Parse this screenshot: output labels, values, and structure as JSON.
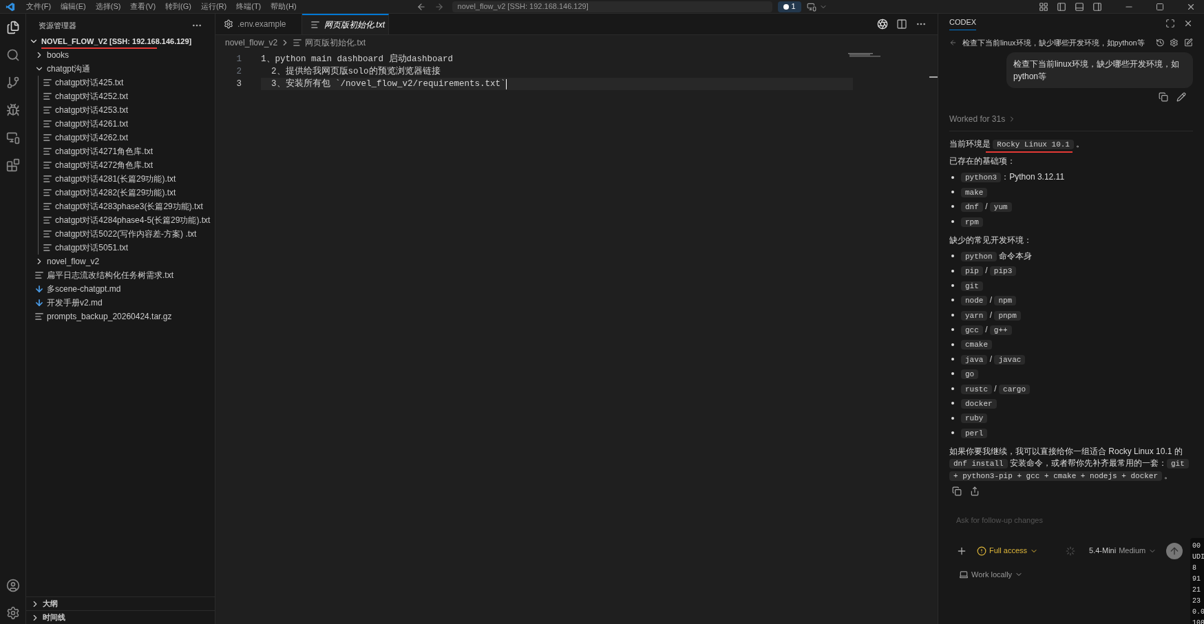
{
  "menu_bar": {
    "items": [
      "文件(F)",
      "编辑(E)",
      "选择(S)",
      "查看(V)",
      "转到(G)",
      "运行(R)",
      "终端(T)",
      "帮助(H)"
    ],
    "search": "novel_flow_v2 [SSH: 192.168.146.129]",
    "badge": "1"
  },
  "explorer": {
    "title": "资源管理器",
    "root": {
      "label": "NOVEL_FLOW_V2 [SSH: 192.168.146.129]",
      "expanded": true,
      "underlined": true
    },
    "tree": [
      {
        "kind": "folder",
        "label": "books",
        "expanded": false
      },
      {
        "kind": "folder",
        "label": "chatgpt沟通",
        "expanded": true,
        "children": [
          {
            "kind": "txt",
            "label": "chatgpt对话425.txt"
          },
          {
            "kind": "txt",
            "label": "chatgpt对话4252.txt"
          },
          {
            "kind": "txt",
            "label": "chatgpt对话4253.txt"
          },
          {
            "kind": "txt",
            "label": "chatgpt对话4261.txt"
          },
          {
            "kind": "txt",
            "label": "chatgpt对话4262.txt"
          },
          {
            "kind": "txt",
            "label": "chatgpt对话4271角色库.txt"
          },
          {
            "kind": "txt",
            "label": "chatgpt对话4272角色库.txt"
          },
          {
            "kind": "txt",
            "label": "chatgpt对话4281(长篇29功能).txt"
          },
          {
            "kind": "txt",
            "label": "chatgpt对话4282(长篇29功能).txt"
          },
          {
            "kind": "txt",
            "label": "chatgpt对话4283phase3(长篇29功能).txt"
          },
          {
            "kind": "txt",
            "label": "chatgpt对话4284phase4-5(长篇29功能).txt"
          },
          {
            "kind": "txt",
            "label": "chatgpt对话5022(写作内容差-方案) .txt"
          },
          {
            "kind": "txt",
            "label": "chatgpt对话5051.txt"
          }
        ]
      },
      {
        "kind": "folder",
        "label": "novel_flow_v2",
        "expanded": false
      },
      {
        "kind": "txt",
        "label": "扁平日志流改结构化任务树需求.txt"
      },
      {
        "kind": "md",
        "label": "多scene-chatgpt.md"
      },
      {
        "kind": "md",
        "label": "开发手册v2.md"
      },
      {
        "kind": "txt",
        "label": "prompts_backup_20260424.tar.gz"
      }
    ],
    "sections": [
      {
        "label": "大纲",
        "expanded": false
      },
      {
        "label": "时间线",
        "expanded": false
      }
    ]
  },
  "editor": {
    "tabs": [
      {
        "label": ".env.example",
        "kind": "config",
        "selected": false
      },
      {
        "label": "网页版初始化.txt",
        "kind": "txt",
        "selected": true
      }
    ],
    "breadcrumb": [
      "novel_flow_v2",
      "网页版初始化.txt"
    ],
    "lines": [
      {
        "number": "1",
        "text": "1、python main dashboard 启动dashboard",
        "current": false
      },
      {
        "number": "2",
        "text": "  2、提供给我网页版solo的预览浏览器链接",
        "current": false
      },
      {
        "number": "3",
        "text": "  3、安装所有包 `/novel_flow_v2/requirements.txt`",
        "current": true
      }
    ]
  },
  "codex": {
    "tab": "CODEX",
    "thread_title": "检查下当前linux环境，缺少哪些开发环境，如python等",
    "user_message": "检查下当前linux环境，缺少哪些开发环境，如python等",
    "worked": "Worked for 31s",
    "blocks": [
      {
        "kind": "para",
        "parts": [
          {
            "kind": "text",
            "text": "当前环境是 "
          },
          {
            "kind": "code",
            "text": "Rocky Linux 10.1",
            "underlined": true
          },
          {
            "kind": "text",
            "text": " 。"
          }
        ]
      },
      {
        "kind": "para",
        "parts": [
          {
            "kind": "text",
            "text": "已存在的基础项："
          }
        ]
      },
      {
        "kind": "list",
        "items": [
          [
            {
              "kind": "code",
              "text": "python3"
            },
            {
              "kind": "text",
              "text": "：Python 3.12.11"
            }
          ],
          [
            {
              "kind": "code",
              "text": "make"
            }
          ],
          [
            {
              "kind": "code",
              "text": "dnf"
            },
            {
              "kind": "text",
              "text": " / "
            },
            {
              "kind": "code",
              "text": "yum"
            }
          ],
          [
            {
              "kind": "code",
              "text": "rpm"
            }
          ]
        ]
      },
      {
        "kind": "para",
        "parts": [
          {
            "kind": "text",
            "text": "缺少的常见开发环境："
          }
        ]
      },
      {
        "kind": "list",
        "items": [
          [
            {
              "kind": "code",
              "text": "python"
            },
            {
              "kind": "text",
              "text": " 命令本身"
            }
          ],
          [
            {
              "kind": "code",
              "text": "pip"
            },
            {
              "kind": "text",
              "text": " / "
            },
            {
              "kind": "code",
              "text": "pip3"
            }
          ],
          [
            {
              "kind": "code",
              "text": "git"
            }
          ],
          [
            {
              "kind": "code",
              "text": "node"
            },
            {
              "kind": "text",
              "text": " / "
            },
            {
              "kind": "code",
              "text": "npm"
            }
          ],
          [
            {
              "kind": "code",
              "text": "yarn"
            },
            {
              "kind": "text",
              "text": " / "
            },
            {
              "kind": "code",
              "text": "pnpm"
            }
          ],
          [
            {
              "kind": "code",
              "text": "gcc"
            },
            {
              "kind": "text",
              "text": " / "
            },
            {
              "kind": "code",
              "text": "g++"
            }
          ],
          [
            {
              "kind": "code",
              "text": "cmake"
            }
          ],
          [
            {
              "kind": "code",
              "text": "java"
            },
            {
              "kind": "text",
              "text": " / "
            },
            {
              "kind": "code",
              "text": "javac"
            }
          ],
          [
            {
              "kind": "code",
              "text": "go"
            }
          ],
          [
            {
              "kind": "code",
              "text": "rustc"
            },
            {
              "kind": "text",
              "text": " / "
            },
            {
              "kind": "code",
              "text": "cargo"
            }
          ],
          [
            {
              "kind": "code",
              "text": "docker"
            }
          ],
          [
            {
              "kind": "code",
              "text": "ruby"
            }
          ],
          [
            {
              "kind": "code",
              "text": "perl"
            }
          ]
        ]
      },
      {
        "kind": "para",
        "parts": [
          {
            "kind": "text",
            "text": "如果你要我继续，我可以直接给你一组适合 Rocky Linux 10.1 的 "
          },
          {
            "kind": "code",
            "text": "dnf install"
          },
          {
            "kind": "text",
            "text": " 安装命令，或者帮你先补齐最常用的一套："
          },
          {
            "kind": "code",
            "text": "git + python3-pip + gcc + cmake + nodejs + docker"
          },
          {
            "kind": "text",
            "text": " 。"
          }
        ]
      }
    ],
    "input": {
      "placeholder": "Ask for follow-up changes"
    },
    "access": "Full access",
    "model": "5.4-Mini",
    "effort": "Medium",
    "location": "Work locally"
  },
  "terminal_overlay": [
    "00",
    "UDI",
    "8",
    "91",
    "21",
    "23",
    "0.0",
    "108"
  ]
}
